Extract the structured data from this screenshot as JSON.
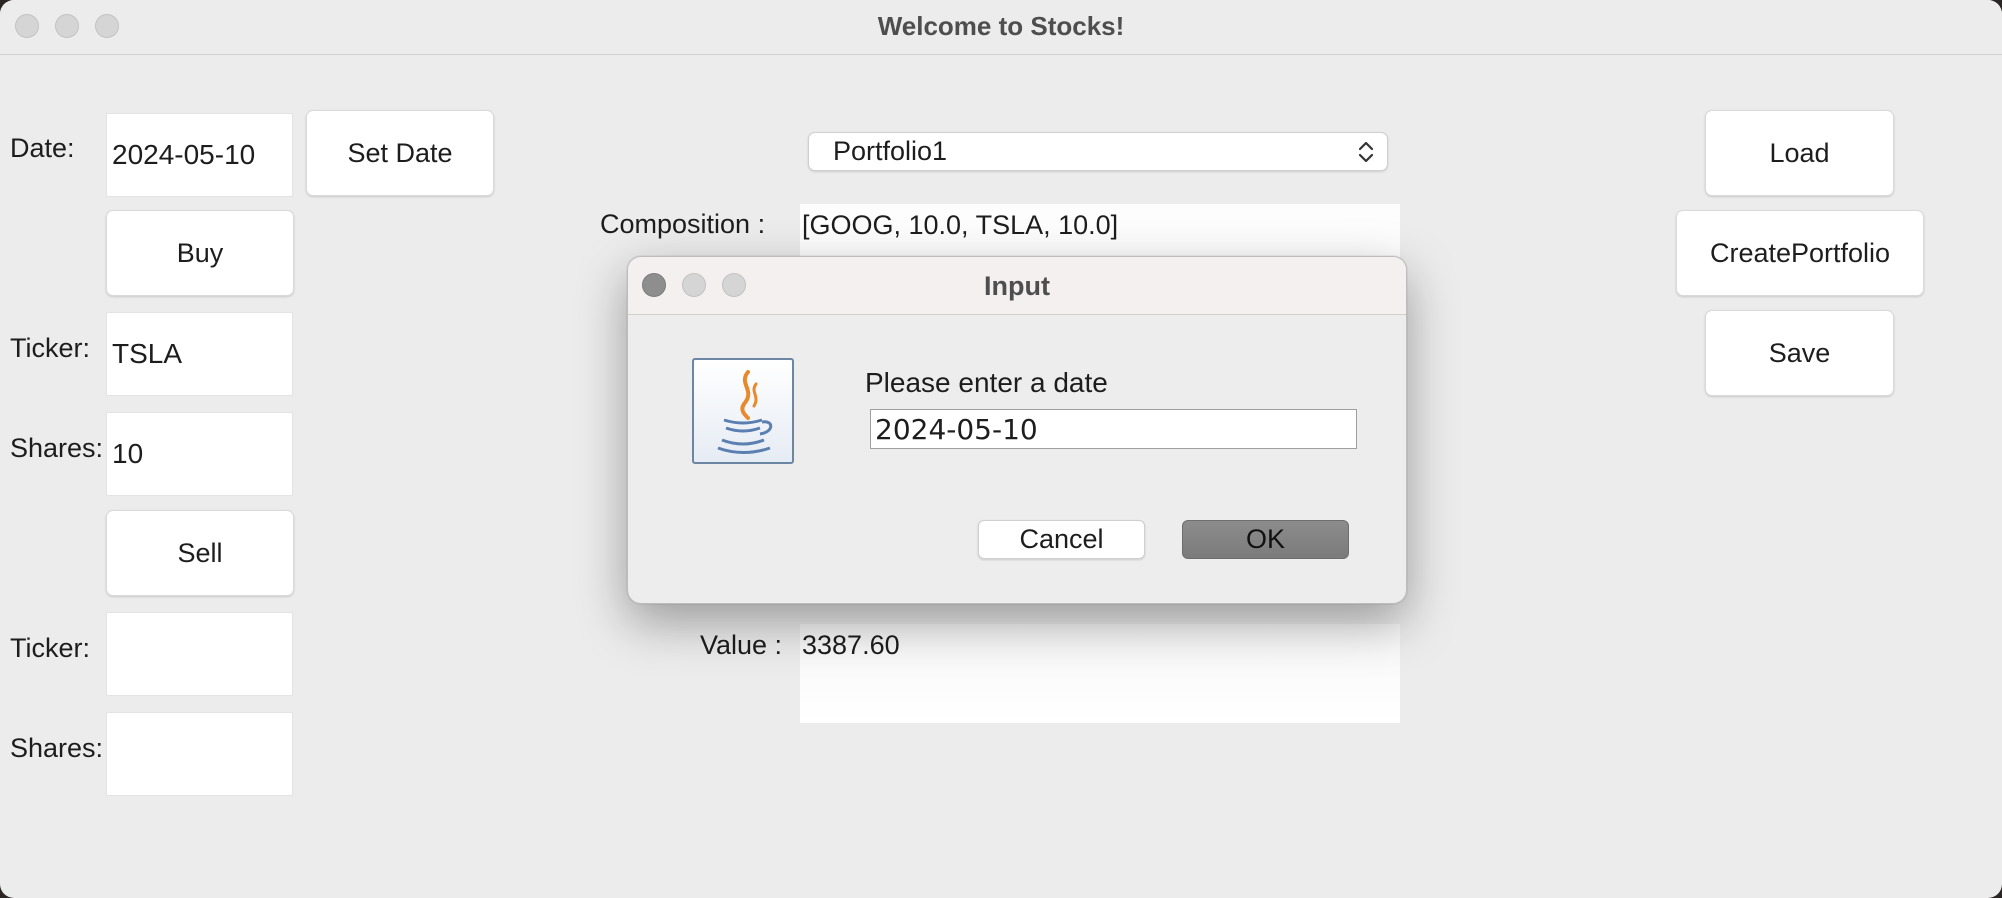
{
  "window": {
    "title": "Welcome to Stocks!"
  },
  "date": {
    "label": "Date:",
    "value": "2024-05-10",
    "set_button": "Set Date"
  },
  "buy": {
    "button": "Buy",
    "ticker_label": "Ticker:",
    "ticker_value": "TSLA",
    "shares_label": "Shares:",
    "shares_value": "10"
  },
  "sell": {
    "button": "Sell",
    "ticker_label": "Ticker:",
    "ticker_value": "",
    "shares_label": "Shares:",
    "shares_value": ""
  },
  "portfolio": {
    "selected": "Portfolio1",
    "composition_label": "Composition :",
    "composition_value": "[GOOG, 10.0, TSLA, 10.0]",
    "value_label": "Value :",
    "value_value": "3387.60"
  },
  "actions": {
    "load": "Load",
    "create": "CreatePortfolio",
    "save": "Save"
  },
  "dialog": {
    "title": "Input",
    "prompt": "Please enter a date",
    "input_value": "2024-05-10",
    "cancel": "Cancel",
    "ok": "OK",
    "icon": "java-icon"
  },
  "colors": {
    "window_bg": "#ececec",
    "ok_button": "#828282",
    "java_icon_border": "#6d86a4"
  }
}
